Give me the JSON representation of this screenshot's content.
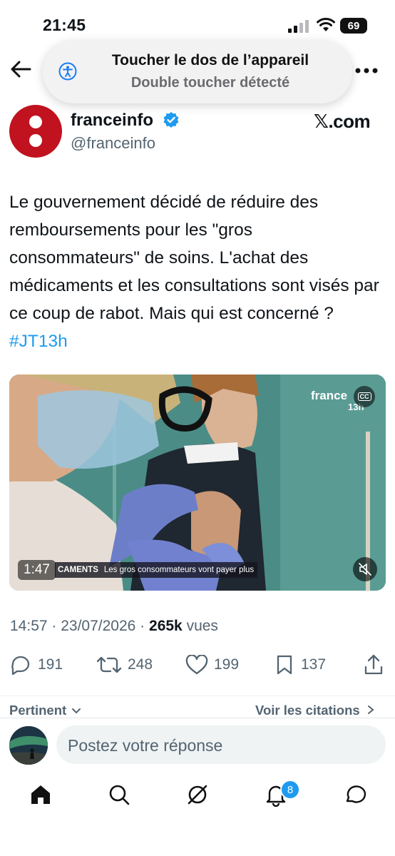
{
  "status_bar": {
    "time": "21:45",
    "battery": "69"
  },
  "toast": {
    "title": "Toucher le dos de l’appareil",
    "subtitle": "Double toucher détecté"
  },
  "account": {
    "display_name": "franceinfo",
    "handle": "@franceinfo",
    "source": "𝕏.com"
  },
  "tweet": {
    "text": "Le gouvernement décidé de réduire des remboursements pour les \"gros consommateurs\" de soins. L'achat des médicaments et les consultations sont visés par ce coup de rabot. Mais qui est concerné ? ",
    "hashtag": "#JT13h"
  },
  "video": {
    "channel_logo": "france",
    "program": "13h",
    "caption_badge": "CC",
    "duration": "1:47",
    "lower_third_label": "CAMENTS",
    "lower_third_text": "Les gros consommateurs vont payer plus"
  },
  "meta": {
    "time": "14:57",
    "date": "23/07/2026",
    "views_count": "265k",
    "views_label": "vues"
  },
  "actions": {
    "replies": "191",
    "reposts": "248",
    "likes": "199",
    "bookmarks": "137"
  },
  "sort": {
    "relevant_label": "Pertinent",
    "quotes_label": "Voir les citations"
  },
  "reply": {
    "placeholder": "Postez votre réponse"
  },
  "bottom_nav": {
    "notifications_badge": "8"
  },
  "colors": {
    "accent": "#1d9bf0",
    "brand": "#c1121f"
  }
}
